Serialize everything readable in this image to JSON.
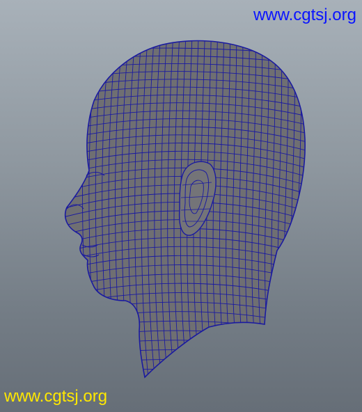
{
  "viewport": {
    "background_top": "#a8b1b9",
    "background_bottom": "#666e77"
  },
  "model": {
    "icon": "head-wireframe-mesh",
    "surface_color": "#6f6f72",
    "wire_color": "#1a1aa0"
  },
  "watermarks": {
    "top": {
      "text": "www.cgtsj.org",
      "color": "#0a14ff"
    },
    "bottom": {
      "text": "www.cgtsj.org",
      "color": "#ffe800"
    }
  }
}
